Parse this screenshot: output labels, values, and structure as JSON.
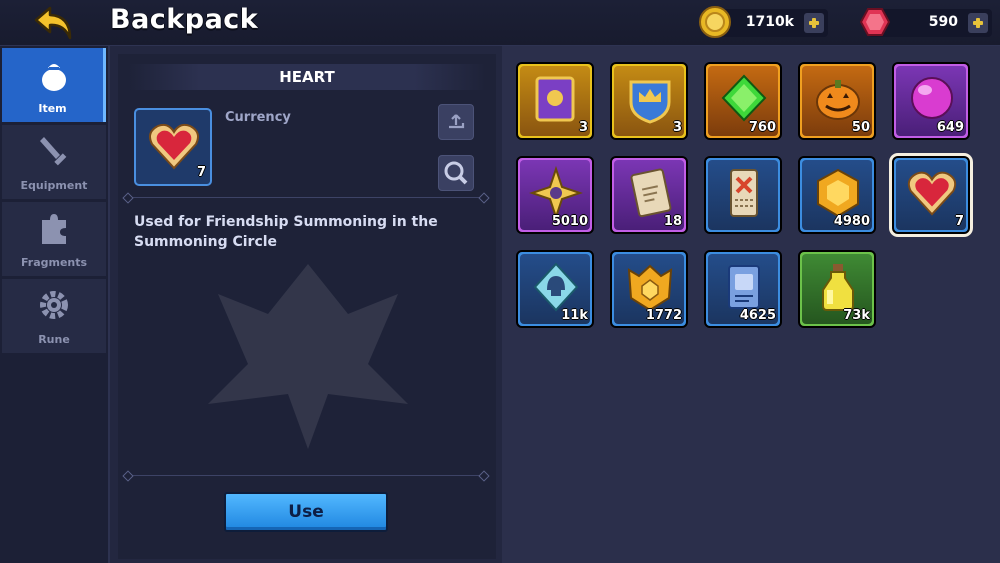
{
  "header": {
    "title": "Backpack",
    "back_icon": "back-arrow-icon",
    "gold": {
      "icon": "gold-coin-icon",
      "value": "1710k",
      "color": "#e8b824"
    },
    "gems": {
      "icon": "red-gem-icon",
      "value": "590",
      "color": "#e03454"
    }
  },
  "sidebar": {
    "tabs": [
      {
        "label": "Item",
        "icon": "bag-icon",
        "active": true
      },
      {
        "label": "Equipment",
        "icon": "sword-icon",
        "active": false
      },
      {
        "label": "Fragments",
        "icon": "puzzle-icon",
        "active": false
      },
      {
        "label": "Rune",
        "icon": "gear-icon",
        "active": false
      }
    ]
  },
  "detail": {
    "name": "HEART",
    "type": "Currency",
    "count": "7",
    "icon": "heart-icon",
    "description": "Used for Friendship Summoning in the Summoning Circle",
    "use_label": "Use"
  },
  "inventory": {
    "items": [
      {
        "icon": "spellbook-icon",
        "count": "3",
        "rarity": "gold"
      },
      {
        "icon": "crown-shield-icon",
        "count": "3",
        "rarity": "gold"
      },
      {
        "icon": "green-gem-icon",
        "count": "760",
        "rarity": "orange"
      },
      {
        "icon": "pumpkin-icon",
        "count": "50",
        "rarity": "orange"
      },
      {
        "icon": "pink-orb-icon",
        "count": "649",
        "rarity": "purple"
      },
      {
        "icon": "compass-star-icon",
        "count": "5010",
        "rarity": "purple"
      },
      {
        "icon": "scroll-icon",
        "count": "18",
        "rarity": "purple"
      },
      {
        "icon": "ticket-icon",
        "count": "",
        "rarity": "blue"
      },
      {
        "icon": "hex-medal-icon",
        "count": "4980",
        "rarity": "blue"
      },
      {
        "icon": "heart-icon",
        "count": "7",
        "rarity": "blue",
        "selected": true
      },
      {
        "icon": "helmet-crystal-icon",
        "count": "11k",
        "rarity": "blue"
      },
      {
        "icon": "gold-emblem-icon",
        "count": "1772",
        "rarity": "blue"
      },
      {
        "icon": "card-icon",
        "count": "4625",
        "rarity": "blue"
      },
      {
        "icon": "potion-icon",
        "count": "73k",
        "rarity": "green"
      }
    ]
  }
}
